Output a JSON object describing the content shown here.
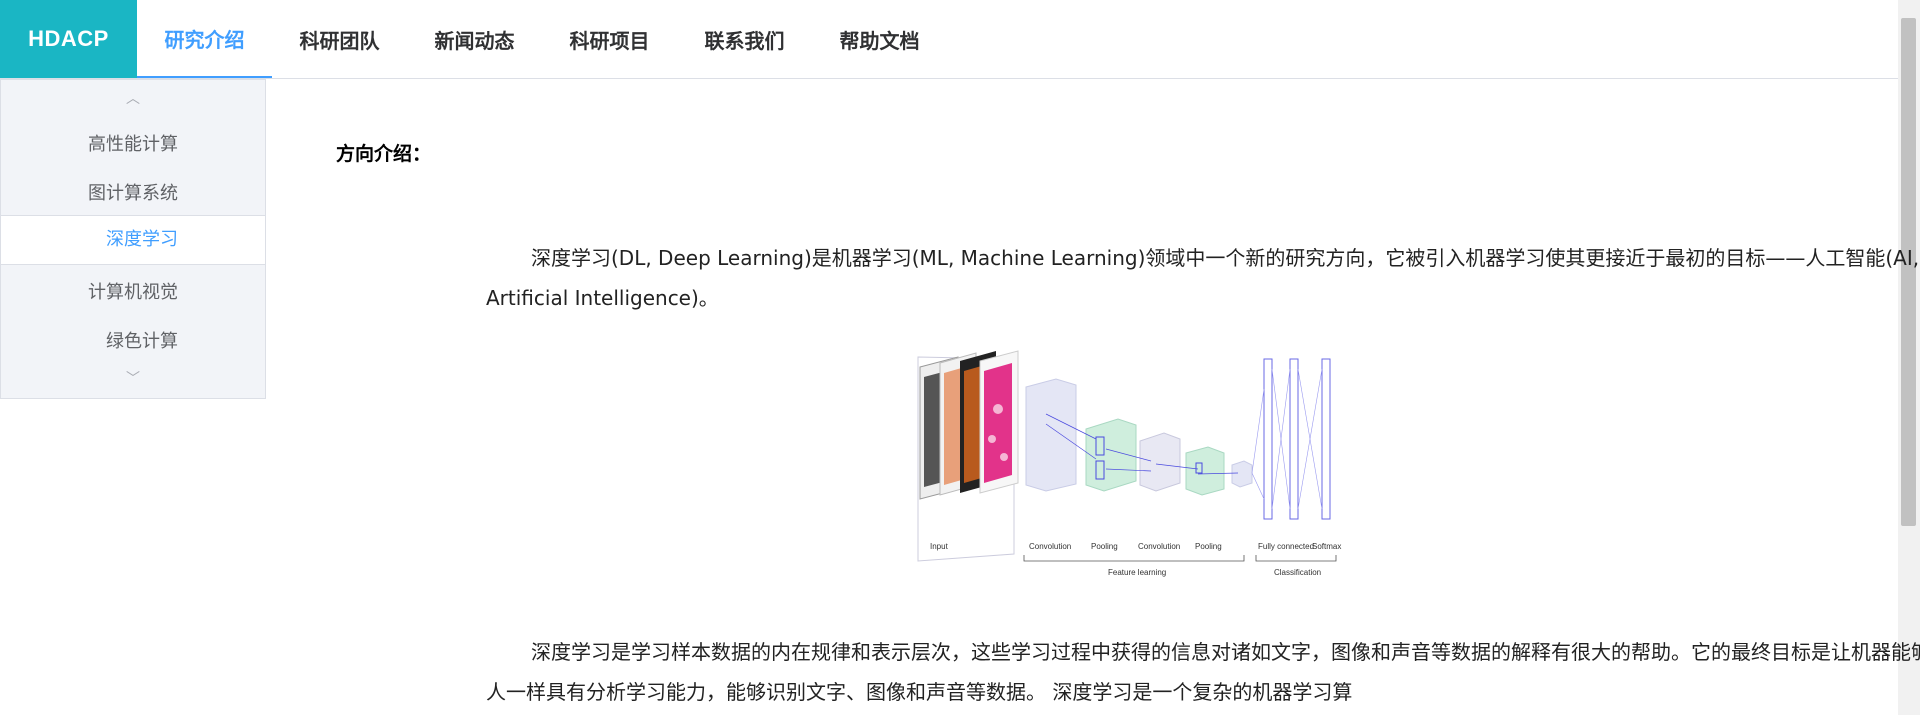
{
  "header": {
    "logo": "HDACP",
    "nav": [
      {
        "label": "研究介绍",
        "active": true
      },
      {
        "label": "科研团队",
        "active": false
      },
      {
        "label": "新闻动态",
        "active": false
      },
      {
        "label": "科研项目",
        "active": false
      },
      {
        "label": "联系我们",
        "active": false
      },
      {
        "label": "帮助文档",
        "active": false
      }
    ]
  },
  "sidebar": {
    "up_arrow": "︿",
    "down_arrow": "﹀",
    "items": [
      {
        "label": "高性能计算",
        "active": false
      },
      {
        "label": "图计算系统",
        "active": false
      },
      {
        "label": "深度学习",
        "active": true
      },
      {
        "label": "计算机视觉",
        "active": false
      },
      {
        "label": "绿色计算",
        "active": false
      }
    ]
  },
  "main": {
    "section_title": "方向介绍：",
    "paragraph1": "深度学习(DL, Deep Learning)是机器学习(ML, Machine Learning)领域中一个新的研究方向，它被引入机器学习使其更接近于最初的目标——人工智能(AI, Artificial Intelligence)。",
    "paragraph2": "深度学习是学习样本数据的内在规律和表示层次，这些学习过程中获得的信息对诸如文字，图像和声音等数据的解释有很大的帮助。它的最终目标是让机器能够像人一样具有分析学习能力，能够识别文字、图像和声音等数据。 深度学习是一个复杂的机器学习算",
    "figure": {
      "labels": {
        "input": "Input",
        "conv1": "Convolution",
        "pool1": "Pooling",
        "conv2": "Convolution",
        "pool2": "Pooling",
        "fc": "Fully connected",
        "softmax": "Softmax",
        "feature_learning": "Feature learning",
        "classification": "Classification"
      }
    }
  },
  "colors": {
    "logo_bg": "#1ab6c4",
    "accent": "#409eff",
    "sidebar_bg": "#f2f4f8"
  }
}
